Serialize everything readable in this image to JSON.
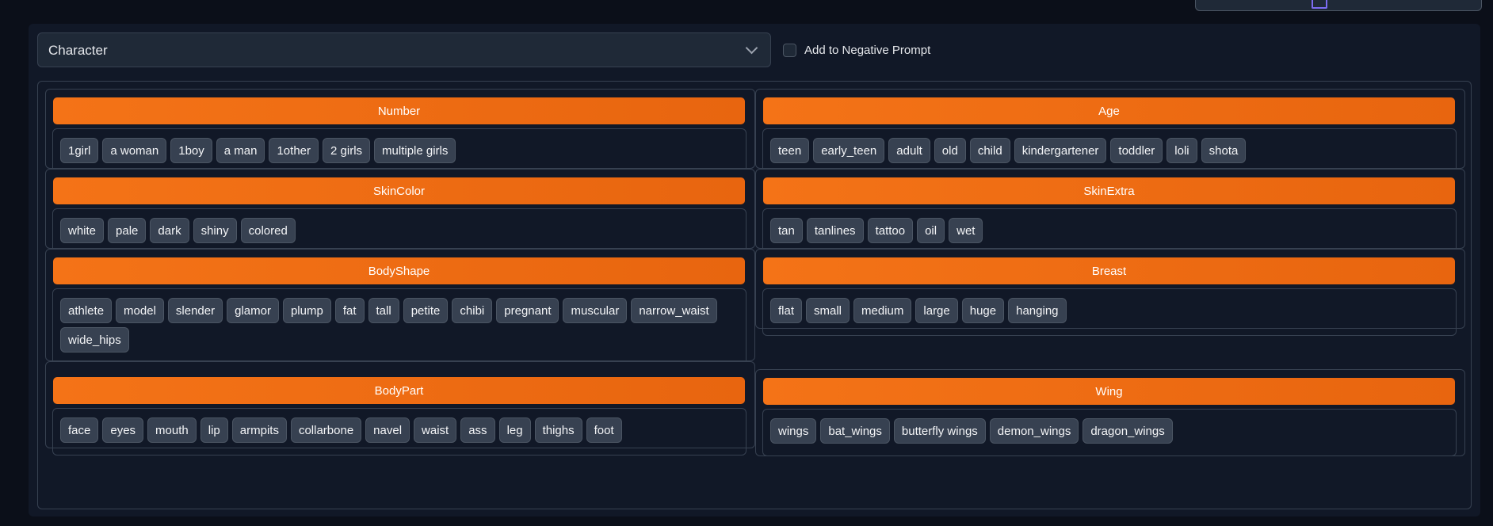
{
  "category_select": {
    "value": "Character"
  },
  "negative_prompt": {
    "label": "Add to Negative Prompt",
    "checked": false
  },
  "accent_color": "#ef6a12",
  "groups": [
    {
      "title": "Number",
      "tags": [
        "1girl",
        "a woman",
        "1boy",
        "a man",
        "1other",
        "2 girls",
        "multiple girls"
      ]
    },
    {
      "title": "Age",
      "tags": [
        "teen",
        "early_teen",
        "adult",
        "old",
        "child",
        "kindergartener",
        "toddler",
        "loli",
        "shota"
      ]
    },
    {
      "title": "SkinColor",
      "tags": [
        "white",
        "pale",
        "dark",
        "shiny",
        "colored"
      ]
    },
    {
      "title": "SkinExtra",
      "tags": [
        "tan",
        "tanlines",
        "tattoo",
        "oil",
        "wet"
      ]
    },
    {
      "title": "BodyShape",
      "tags": [
        "athlete",
        "model",
        "slender",
        "glamor",
        "plump",
        "fat",
        "tall",
        "petite",
        "chibi",
        "pregnant",
        "muscular",
        "narrow_waist",
        "wide_hips"
      ]
    },
    {
      "title": "Breast",
      "tags": [
        "flat",
        "small",
        "medium",
        "large",
        "huge",
        "hanging"
      ]
    },
    {
      "title": "BodyPart",
      "tags": [
        "face",
        "eyes",
        "mouth",
        "lip",
        "armpits",
        "collarbone",
        "navel",
        "waist",
        "ass",
        "leg",
        "thighs",
        "foot"
      ]
    },
    {
      "title": "Wing",
      "tags": [
        "wings",
        "bat_wings",
        "butterfly wings",
        "demon_wings",
        "dragon_wings"
      ]
    }
  ]
}
